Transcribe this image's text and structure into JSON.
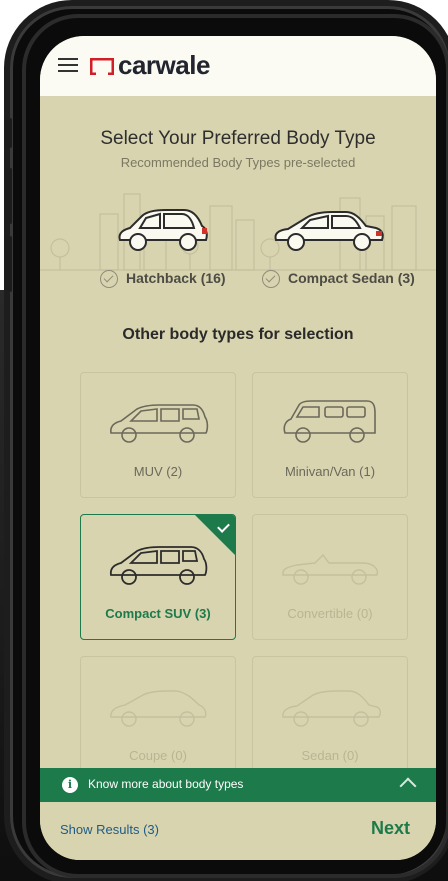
{
  "app": {
    "logo": "carwale"
  },
  "icons": {
    "menu": "hamburger-icon",
    "info": "info-icon",
    "expand": "chevron-up-icon",
    "check": "check-icon"
  },
  "colors": {
    "accent": "#1d7a4a",
    "link": "#1d5c86",
    "overlay": "#d9d4b0"
  },
  "page": {
    "title": "Select Your Preferred Body Type",
    "subtitle": "Recommended Body Types pre-selected"
  },
  "recommended": [
    {
      "label": "Hatchback (16)",
      "checked": true
    },
    {
      "label": "Compact Sedan (3)",
      "checked": true
    }
  ],
  "other": {
    "title": "Other body types for selection",
    "items": [
      {
        "label": "MUV (2)",
        "selected": false,
        "disabled": false
      },
      {
        "label": "Minivan/Van (1)",
        "selected": false,
        "disabled": false
      },
      {
        "label": "Compact SUV (3)",
        "selected": true,
        "disabled": false
      },
      {
        "label": "Convertible (0)",
        "selected": false,
        "disabled": true
      },
      {
        "label": "Coupe (0)",
        "selected": false,
        "disabled": true
      },
      {
        "label": "Sedan (0)",
        "selected": false,
        "disabled": true
      }
    ]
  },
  "info_bar": {
    "text": "Know more about body types",
    "info_glyph": "i"
  },
  "footer": {
    "show_results": "Show Results (3)",
    "next": "Next"
  }
}
